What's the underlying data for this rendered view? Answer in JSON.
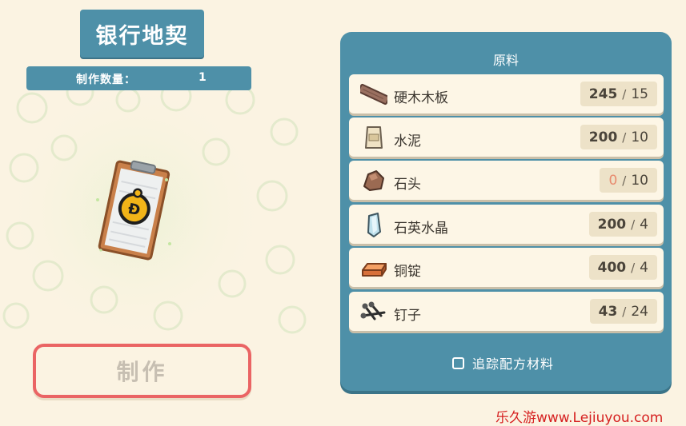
{
  "recipe": {
    "title": "银行地契",
    "quantity_label": "制作数量：",
    "quantity_value": "1",
    "item_icon": "blueprint-deed-icon",
    "craft_label": "制作"
  },
  "materials": {
    "title": "原料",
    "items": [
      {
        "name": "硬木木板",
        "have": "245",
        "need": "15",
        "icon": "hardwood-plank-icon"
      },
      {
        "name": "水泥",
        "have": "200",
        "need": "10",
        "icon": "cement-bag-icon"
      },
      {
        "name": "石头",
        "have": "0",
        "need": "10",
        "icon": "stone-icon"
      },
      {
        "name": "石英水晶",
        "have": "200",
        "need": "4",
        "icon": "quartz-crystal-icon"
      },
      {
        "name": "铜锭",
        "have": "400",
        "need": "4",
        "icon": "copper-ingot-icon"
      },
      {
        "name": "钉子",
        "have": "43",
        "need": "24",
        "icon": "nails-icon"
      }
    ],
    "track_label": "追踪配方材料"
  },
  "colors": {
    "panel": "#4e90a8",
    "background": "#fbf3e2",
    "craft_border": "#ea6464",
    "lacking": "#e88a6e"
  },
  "watermark": "乐久游www.Lejiuyou.com"
}
